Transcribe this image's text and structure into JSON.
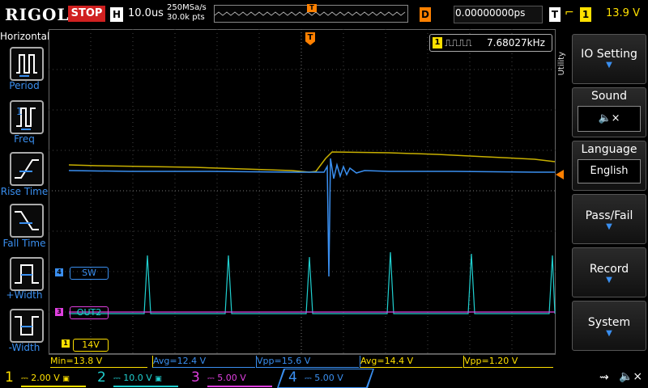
{
  "topbar": {
    "logo": "RIGOL",
    "run_state": "STOP",
    "timebase_label": "H",
    "timebase_value": "10.0us",
    "sample_rate": "250MSa/s",
    "memory_depth": "30.0k pts",
    "trigger_marker": "T",
    "delay_label": "D",
    "delay_value": "0.00000000ps",
    "trigger_label": "T",
    "trigger_source": "1",
    "trigger_level": "13.9 V"
  },
  "left_panel": {
    "title": "Horizontal",
    "buttons": [
      "Period",
      "Freq",
      "Rise Time",
      "Fall Time",
      "+Width",
      "-Width"
    ]
  },
  "freq_counter": {
    "channel": "1",
    "value": "7.68027kHz"
  },
  "channel_markers": {
    "ch4_label": "SW",
    "ch3_label": "OUT2",
    "ch1_label": "14V",
    "ch4_num": "4",
    "ch3_num": "3",
    "ch1_num": "1"
  },
  "measurements": [
    {
      "text": "Min=13.8 V",
      "color": "#ffe000"
    },
    {
      "text": "Avg=12.4 V",
      "color": "#3a8ff0"
    },
    {
      "text": "Vpp=15.6 V",
      "color": "#3a8ff0"
    },
    {
      "text": "Avg=14.4 V",
      "color": "#ffe000"
    },
    {
      "text": "Vpp=1.20 V",
      "color": "#ffe000"
    }
  ],
  "right_menu": {
    "tab": "Utility",
    "items": [
      {
        "label": "IO Setting",
        "sub": "▼"
      },
      {
        "label": "Sound",
        "sub": "🔈×"
      },
      {
        "label": "Language",
        "sub": "English"
      },
      {
        "label": "Pass/Fail",
        "sub": "▼"
      },
      {
        "label": "Record",
        "sub": "▼"
      },
      {
        "label": "System",
        "sub": "▼"
      }
    ]
  },
  "channels": [
    {
      "num": "1",
      "scale": "2.00 V",
      "color": "#ffe000"
    },
    {
      "num": "2",
      "scale": "10.0 V",
      "color": "#20d0d0"
    },
    {
      "num": "3",
      "scale": "5.00 V",
      "color": "#e040e0"
    },
    {
      "num": "4",
      "scale": "5.00 V",
      "color": "#3a8ff0"
    }
  ],
  "colors": {
    "ch1": "#ffe000",
    "ch2": "#20d0d0",
    "ch3": "#e040e0",
    "ch4": "#3a8ff0",
    "trigger": "#ff8000",
    "stop": "#d02020"
  }
}
